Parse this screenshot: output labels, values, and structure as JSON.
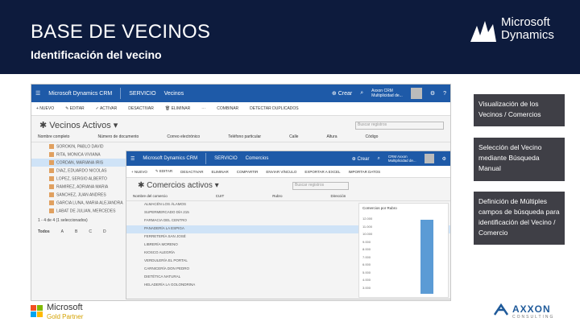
{
  "header": {
    "title": "BASE DE VECINOS",
    "subtitle": "Identificación del vecino",
    "brand_line1": "Microsoft",
    "brand_line2": "Dynamics"
  },
  "back_window": {
    "app": "Microsoft Dynamics CRM",
    "area": "SERVICIO",
    "entity": "Vecinos",
    "create": "Crear",
    "user_line1": "Axxon CRM",
    "user_line2": "Multiplicidad de...",
    "commands": [
      "+ NUEVO",
      "✎ EDITAR",
      "✓ ACTIVAR",
      "DESACTIVAR",
      "🗑 ELIMINAR",
      "⋯",
      "COMBINAR",
      "DETECTAR DUPLICADOS"
    ],
    "view_title": "Vecinos Activos",
    "search_placeholder": "Buscar registros",
    "columns": [
      "Nombre completo",
      "Número de documento",
      "Correo electrónico",
      "Teléfono particular",
      "Calle",
      "Altura",
      "Código"
    ],
    "rows": [
      "SOROKIN, PABLO DAVID",
      "RITA, MONICA VIVIANA",
      "CORDAN, MARIANA IRIS",
      "DIAZ, EDUARDO NICOLAS",
      "LOPEZ, SERGIO ALBERTO",
      "RAMIREZ, ADRIANA MARIA",
      "SANCHEZ, JUAN ANDRES",
      "GARCIA LUNA, MARIA ALEJANDRA",
      "LABAT DE JULIAN, MERCEDES"
    ],
    "footer": "1 - 4 de 4 (1 seleccionados)",
    "alpha": [
      "Todos",
      "A",
      "B",
      "C",
      "D"
    ]
  },
  "front_window": {
    "app": "Microsoft Dynamics CRM",
    "area": "SERVICIO",
    "entity": "Comercios",
    "create": "Crear",
    "user_line1": "CRM Axxon",
    "user_line2": "Multiplicidad de...",
    "commands": [
      "+ NUEVO",
      "✎ EDITAR",
      "DESACTIVAR",
      "ELIMINAR",
      "COMPARTIR",
      "ENVIAR VÍNCULO",
      "EXPORTAR A EXCEL",
      "IMPORTAR DATOS"
    ],
    "view_title": "Comercios activos",
    "search_placeholder": "Buscar registros",
    "columns": [
      "Nombre del comercio",
      "CUIT",
      "Rubro",
      "Dirección"
    ],
    "rows": [
      "ALMACÉN LOS ÁLAMOS",
      "SUPERMERCADO DÍA 215",
      "FARMACIA DEL CENTRO",
      "PANADERÍA LA ESPIGA",
      "FERRETERÍA SAN JOSÉ",
      "LIBRERÍA MORENO",
      "KIOSCO ALEGRÍA",
      "VERDULERÍA EL PORTAL",
      "CARNICERÍA DON PEDRO",
      "DIETÉTICA NATURAL",
      "HELADERÍA LA GOLONDRINA"
    ],
    "chart_caption": "Comercios por Rubro",
    "chart_ticks": [
      "12.000",
      "11.000",
      "10.000",
      "9.000",
      "8.000",
      "7.000",
      "6.000",
      "5.000",
      "4.000",
      "3.000"
    ]
  },
  "notes": [
    "Visualización de los Vecinos / Comercios",
    "Selección del Vecino mediante Búsqueda Manual",
    "Definición de Múltiples campos de búsqueda para identificación del Vecino / Comercio"
  ],
  "footer": {
    "ms_line1": "Microsoft",
    "ms_line2": "Gold Partner",
    "axxon_line1": "AXXON",
    "axxon_line2": "CONSULTING"
  },
  "colors": {
    "header_bg": "#0d1b3d",
    "crm_blue": "#1e5aa8",
    "note_bg": "#3f3f46",
    "ms_red": "#f25022",
    "ms_green": "#7fba00",
    "ms_blue": "#00a4ef",
    "ms_yellow": "#ffb900"
  }
}
